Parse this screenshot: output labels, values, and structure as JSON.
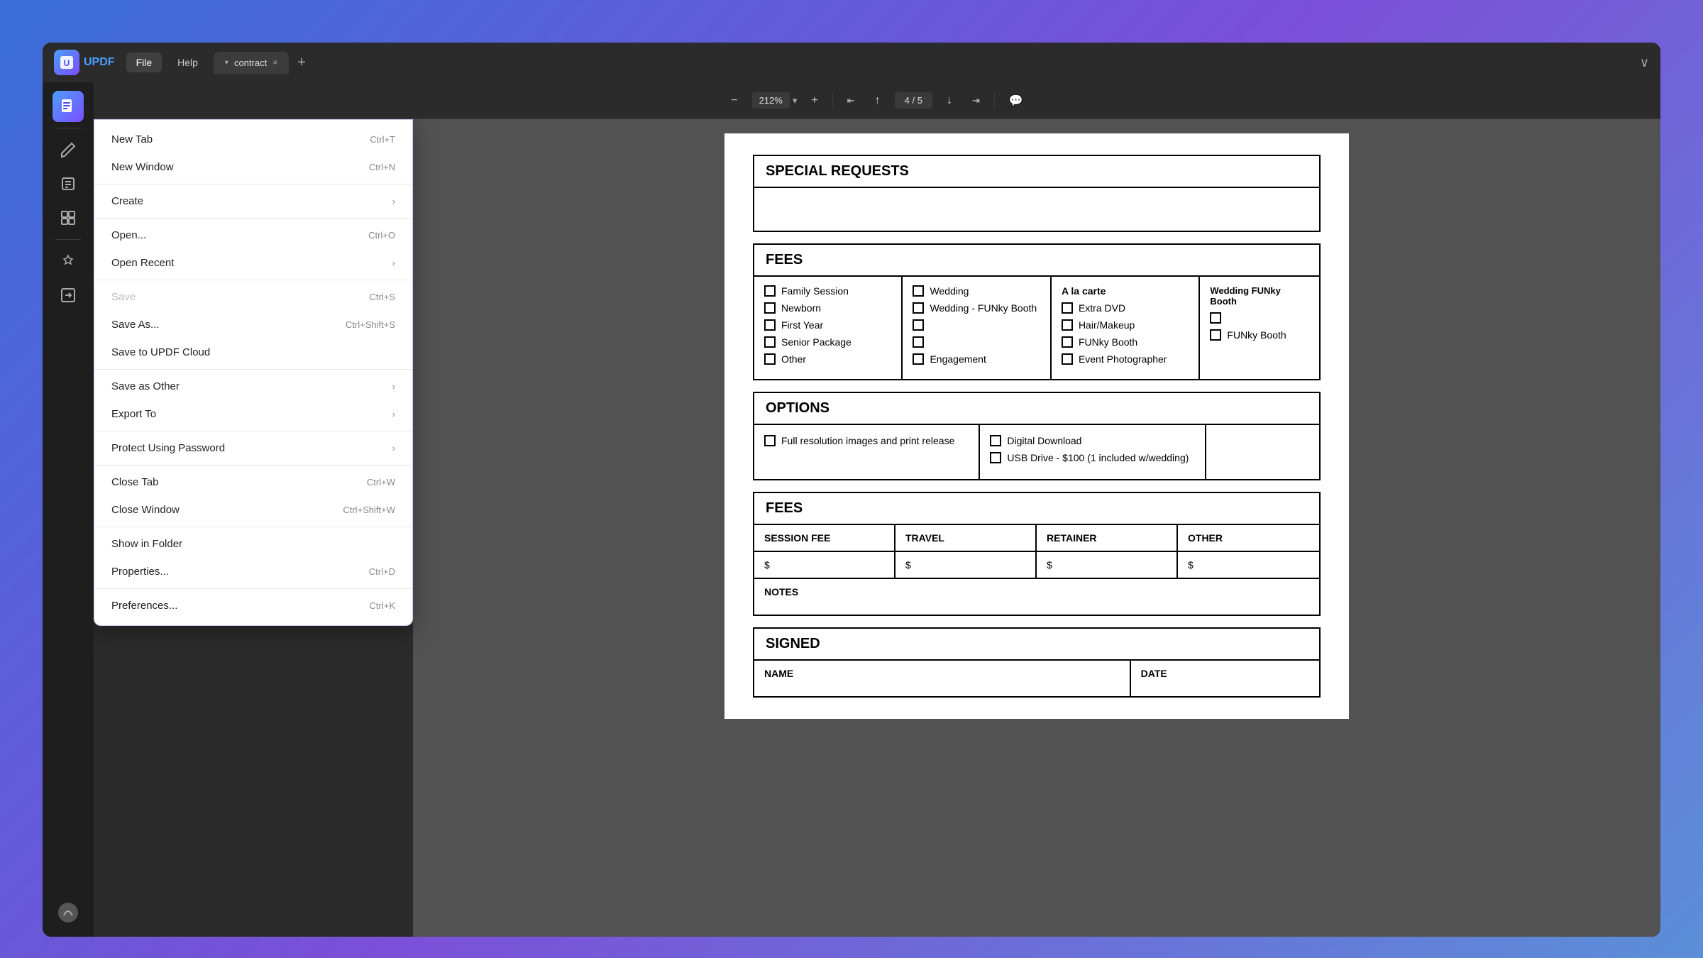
{
  "app": {
    "logo_text": "UPDF",
    "tab_label": "contract",
    "tab_dropdown": "▾",
    "tab_close": "×",
    "tab_add": "+",
    "title_bar_collapse": "∨"
  },
  "menu_buttons": {
    "file": "File",
    "help": "Help"
  },
  "file_menu": {
    "items": [
      {
        "label": "New Tab",
        "shortcut": "Ctrl+T",
        "arrow": false,
        "disabled": false
      },
      {
        "label": "New Window",
        "shortcut": "Ctrl+N",
        "arrow": false,
        "disabled": false
      },
      {
        "separator_after": true
      },
      {
        "label": "Create",
        "shortcut": "",
        "arrow": true,
        "disabled": false
      },
      {
        "separator_after": true
      },
      {
        "label": "Open...",
        "shortcut": "Ctrl+O",
        "arrow": false,
        "disabled": false
      },
      {
        "label": "Open Recent",
        "shortcut": "",
        "arrow": true,
        "disabled": false
      },
      {
        "separator_after": true
      },
      {
        "label": "Save",
        "shortcut": "Ctrl+S",
        "arrow": false,
        "disabled": true
      },
      {
        "label": "Save As...",
        "shortcut": "Ctrl+Shift+S",
        "arrow": false,
        "disabled": false
      },
      {
        "label": "Save to UPDF Cloud",
        "shortcut": "",
        "arrow": false,
        "disabled": false
      },
      {
        "separator_after": true
      },
      {
        "label": "Save as Other",
        "shortcut": "",
        "arrow": true,
        "disabled": false
      },
      {
        "label": "Export To",
        "shortcut": "",
        "arrow": true,
        "disabled": false
      },
      {
        "separator_after": true
      },
      {
        "label": "Protect Using Password",
        "shortcut": "",
        "arrow": true,
        "disabled": false
      },
      {
        "separator_after": true
      },
      {
        "label": "Close Tab",
        "shortcut": "Ctrl+W",
        "arrow": false,
        "disabled": false
      },
      {
        "label": "Close Window",
        "shortcut": "Ctrl+Shift+W",
        "arrow": false,
        "disabled": false
      },
      {
        "separator_after": true
      },
      {
        "label": "Show in Folder",
        "shortcut": "",
        "arrow": false,
        "disabled": false
      },
      {
        "label": "Properties...",
        "shortcut": "Ctrl+D",
        "arrow": false,
        "disabled": false
      },
      {
        "separator_after": true
      },
      {
        "label": "Preferences...",
        "shortcut": "Ctrl+K",
        "arrow": false,
        "disabled": false
      }
    ]
  },
  "toolbar": {
    "zoom_out": "−",
    "zoom_level": "212%",
    "zoom_in": "+",
    "nav_first": "⇤",
    "nav_prev": "↑",
    "page_current": "4",
    "page_total": "5",
    "nav_next": "↓",
    "nav_last": "⇥",
    "comment": "💬"
  },
  "pdf": {
    "special_requests_title": "SPECIAL REQUESTS",
    "fees_title": "FEES",
    "fees_columns": {
      "col1": {
        "items": [
          "Family Session",
          "Newborn",
          "First Year",
          "Senior Package",
          "Other"
        ]
      },
      "col2": {
        "items": [
          "Wedding",
          "Wedding - FUNky Booth",
          "",
          "",
          "Engagement"
        ]
      },
      "col3": {
        "title": "A la carte",
        "items": [
          "Extra DVD",
          "Hair/Makeup",
          "FUNky Booth",
          "Event Photographer"
        ]
      },
      "col4": {
        "title": "Wedding FUNky Booth",
        "items": [
          "",
          "FUNky Booth"
        ]
      }
    },
    "options_title": "OPTIONS",
    "options_col1": "Full resolution images and print release",
    "options_col2_items": [
      "Digital Download",
      "USB Drive - $100 (1 included w/wedding)"
    ],
    "fees_table_title": "FEES",
    "fees_table_headers": [
      "SESSION FEE",
      "TRAVEL",
      "RETAINER",
      "OTHER"
    ],
    "fees_table_values": [
      "$",
      "$",
      "$",
      "$"
    ],
    "notes_label": "NOTES",
    "signed_title": "SIGNED",
    "signed_headers": [
      "NAME",
      "DATE"
    ]
  },
  "sidebar_icons": [
    "📄",
    "✏️",
    "📋",
    "📦",
    "🔧",
    "📎"
  ]
}
